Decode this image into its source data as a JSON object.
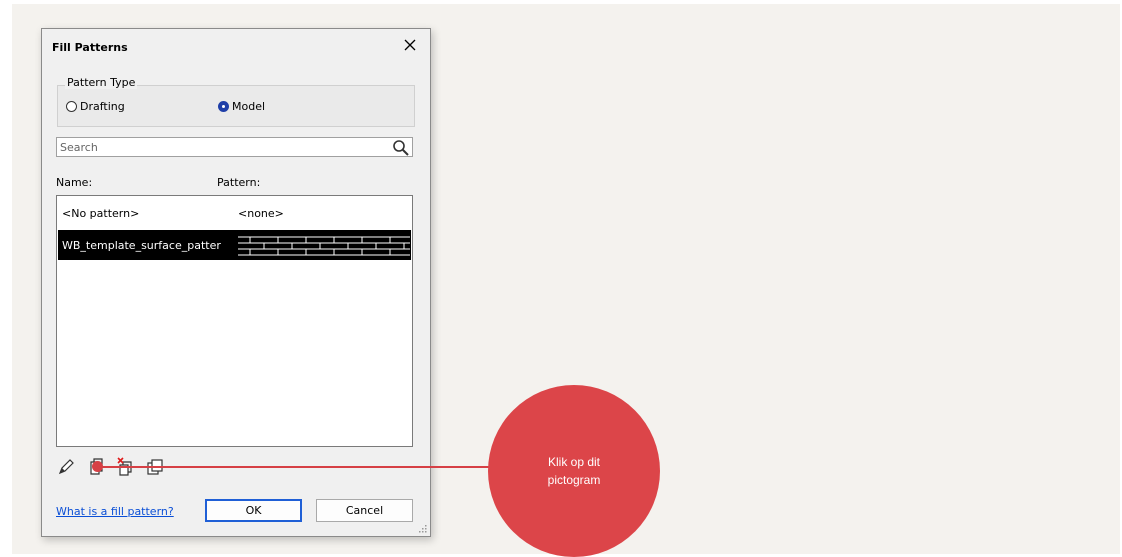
{
  "dialog": {
    "title": "Fill Patterns",
    "pattern_type": {
      "label": "Pattern Type",
      "options": [
        {
          "label": "Drafting",
          "checked": false
        },
        {
          "label": "Model",
          "checked": true
        }
      ]
    },
    "search": {
      "placeholder": "Search",
      "value": ""
    },
    "columns": {
      "name": "Name:",
      "pattern": "Pattern:"
    },
    "rows": [
      {
        "name": "<No pattern>",
        "pattern": "<none>",
        "selected": false
      },
      {
        "name": "WB_template_surface_patter",
        "pattern": "",
        "selected": true
      }
    ],
    "toolbar": [
      "edit-icon",
      "new-pattern-icon",
      "delete-pattern-icon",
      "duplicate-pattern-icon"
    ],
    "help_link": "What is a fill pattern?",
    "ok_label": "OK",
    "cancel_label": "Cancel"
  },
  "callout": {
    "text": "Klik op dit pictogram",
    "color": "#dc4549"
  },
  "colors": {
    "accent": "#1f3fa8",
    "link": "#0b4fd6",
    "selection": "#000000"
  }
}
